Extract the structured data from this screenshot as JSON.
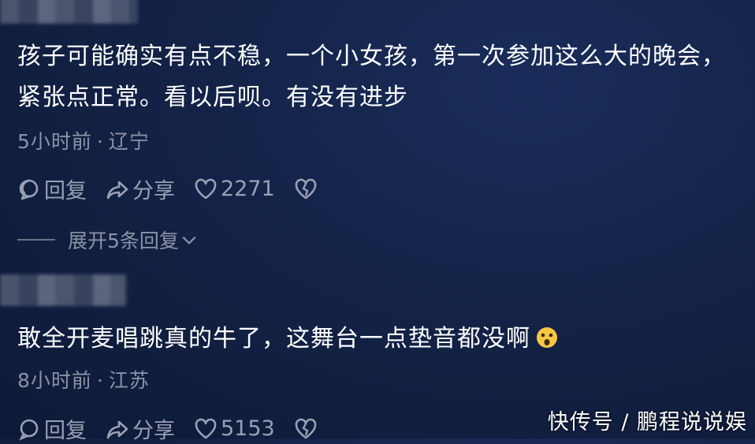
{
  "comment1": {
    "text": "孩子可能确实有点不稳，一个小女孩，第一次参加这么大的晚会，紧张点正常。看以后呗。有没有进步",
    "time": "5小时前",
    "location": "辽宁",
    "reply_label": "回复",
    "share_label": "分享",
    "likes": "2271"
  },
  "expand": {
    "label": "展开5条回复"
  },
  "comment2": {
    "text": "敢全开麦唱跳真的牛了，这舞台一点垫音都没啊",
    "time": "8小时前",
    "location": "江苏",
    "reply_label": "回复",
    "share_label": "分享",
    "likes": "5153"
  },
  "watermark": "快传号 / 鹏程说说娱",
  "icons": {
    "reply": "comment-bubble-icon",
    "share": "share-arrow-icon",
    "like": "heart-icon",
    "dislike": "broken-heart-icon",
    "emoji": "surprised-face-emoji"
  },
  "colors": {
    "background": "#132246",
    "text": "#ffffff",
    "muted": "#8d93a6"
  }
}
